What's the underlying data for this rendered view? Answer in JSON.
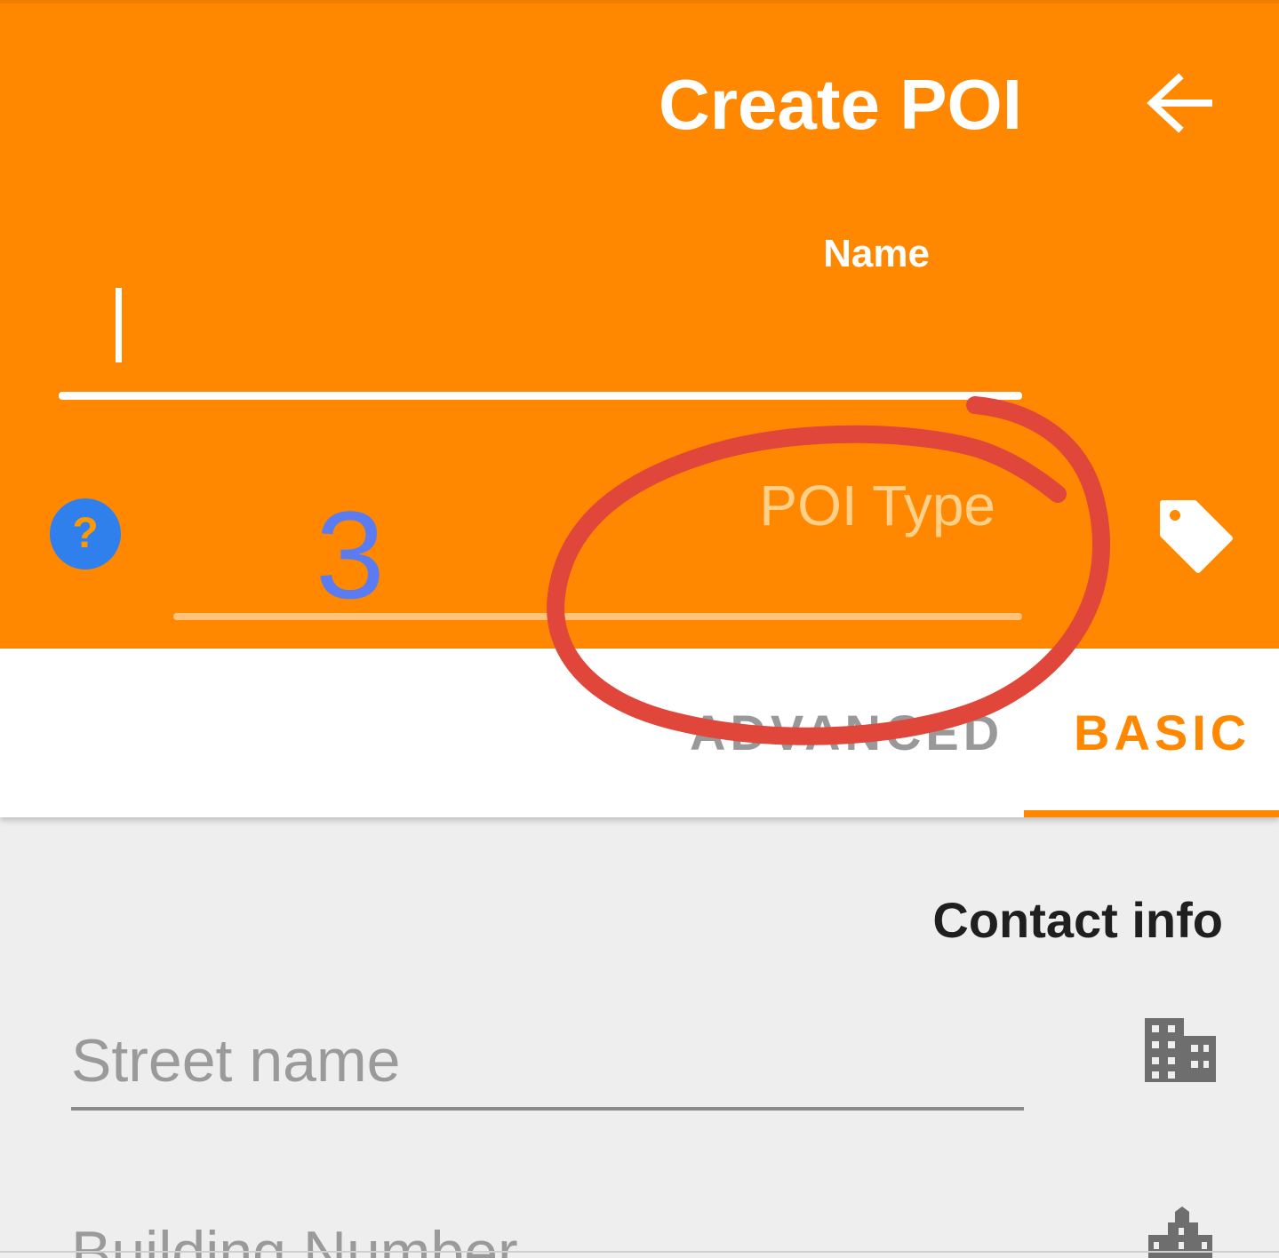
{
  "header": {
    "title": "Create POI",
    "back_icon": "arrow-left-icon",
    "name_label": "Name",
    "name_value": "",
    "poi_type_placeholder": "POI Type",
    "poi_type_count": "3",
    "help_icon": "help-icon",
    "help_symbol": "?",
    "tag_icon": "tag-icon"
  },
  "tabs": [
    {
      "label": "ADVANCED",
      "selected": false
    },
    {
      "label": "BASIC",
      "selected": true
    }
  ],
  "content": {
    "section_title": "Contact info",
    "fields": [
      {
        "placeholder": "Street name",
        "icon": "building-icon"
      },
      {
        "placeholder": "Building Number",
        "icon": "building-number-icon"
      }
    ]
  },
  "colors": {
    "accent": "#ff8800",
    "annotation": "#e0463a",
    "help_blue": "#2f80ed",
    "count_blue": "#5b7cf0"
  }
}
